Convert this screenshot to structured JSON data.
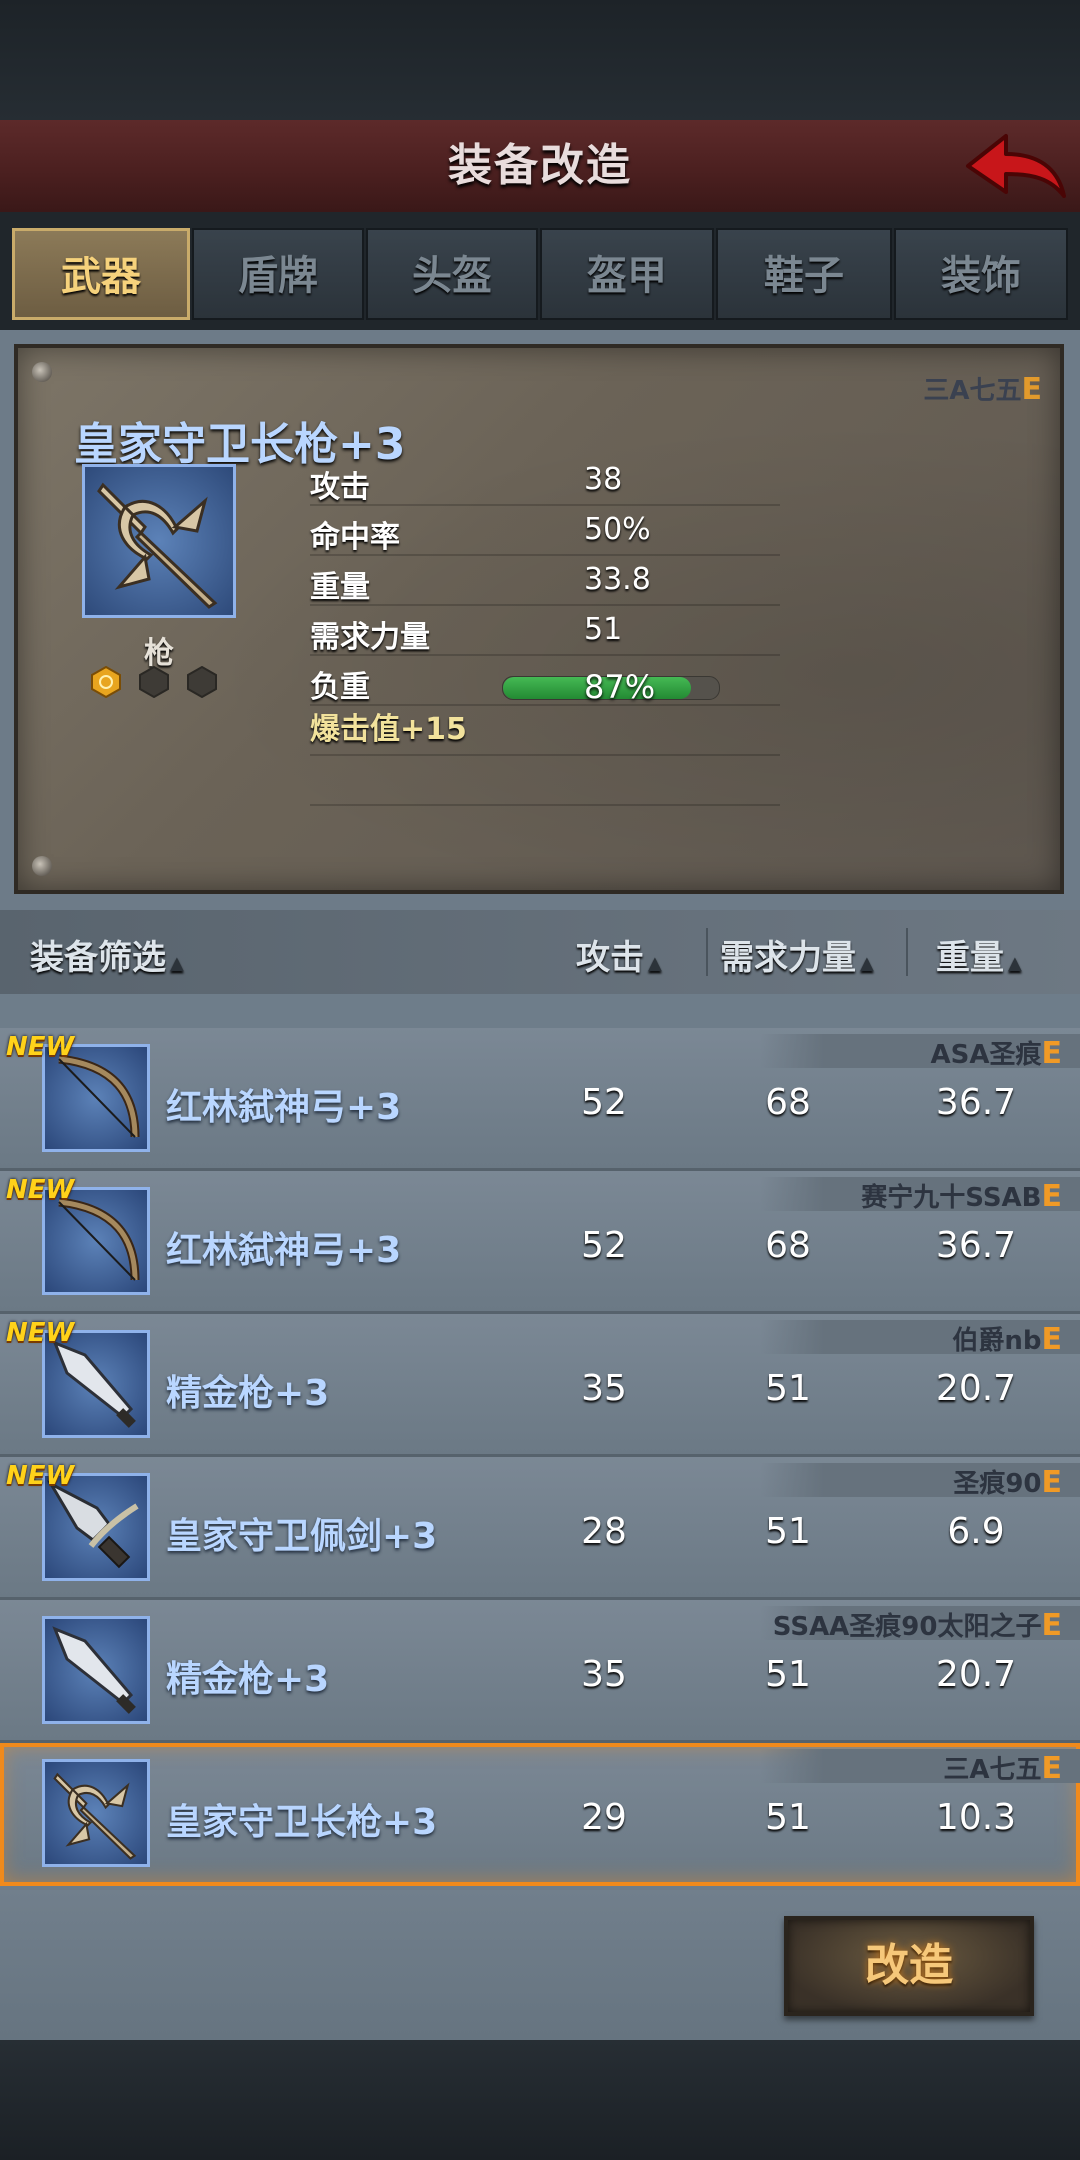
{
  "header": {
    "title": "装备改造",
    "back_icon": "red-back-arrow-icon"
  },
  "tabs": [
    {
      "label": "武器",
      "active": true
    },
    {
      "label": "盾牌",
      "active": false
    },
    {
      "label": "头盔",
      "active": false
    },
    {
      "label": "盔甲",
      "active": false
    },
    {
      "label": "鞋子",
      "active": false
    },
    {
      "label": "装饰",
      "active": false
    }
  ],
  "detail": {
    "title": "皇家守卫长枪+3",
    "owner": "三A七五",
    "grade": "E",
    "type": "枪",
    "icon": "trident-icon",
    "gems": [
      "gold-gem-icon",
      "empty-gem-slot-icon",
      "empty-gem-slot-icon"
    ],
    "stats": [
      {
        "label": "攻击",
        "value": "38"
      },
      {
        "label": "命中率",
        "value": "50%"
      },
      {
        "label": "重量",
        "value": "33.8"
      },
      {
        "label": "需求力量",
        "value": "51"
      },
      {
        "label": "负重",
        "value": "87%"
      }
    ],
    "load_fraction": 0.87,
    "bonus": "爆击值+15"
  },
  "list": {
    "headers": {
      "filter": "装备筛选",
      "attack": "攻击",
      "strength": "需求力量",
      "weight": "重量"
    },
    "rows": [
      {
        "new": "NEW",
        "name": "红林弑神弓+3",
        "attack": "52",
        "strength": "68",
        "weight": "36.7",
        "owner": "ASA圣痕",
        "grade": "E",
        "icon": "bow-icon",
        "selected": false
      },
      {
        "new": "NEW",
        "name": "红林弑神弓+3",
        "attack": "52",
        "strength": "68",
        "weight": "36.7",
        "owner": "赛宁九十SSAB",
        "grade": "E",
        "icon": "bow-icon",
        "selected": false
      },
      {
        "new": "NEW",
        "name": "精金枪+3",
        "attack": "35",
        "strength": "51",
        "weight": "20.7",
        "owner": "伯爵nb",
        "grade": "E",
        "icon": "spear-icon",
        "selected": false
      },
      {
        "new": "NEW",
        "name": "皇家守卫佩剑+3",
        "attack": "28",
        "strength": "51",
        "weight": "6.9",
        "owner": "圣痕90",
        "grade": "E",
        "icon": "sword-icon",
        "selected": false
      },
      {
        "new": "",
        "name": "精金枪+3",
        "attack": "35",
        "strength": "51",
        "weight": "20.7",
        "owner": "SSAA圣痕90太阳之子",
        "grade": "E",
        "icon": "spear-icon",
        "selected": false
      },
      {
        "new": "",
        "name": "皇家守卫长枪+3",
        "attack": "29",
        "strength": "51",
        "weight": "10.3",
        "owner": "三A七五",
        "grade": "E",
        "icon": "trident-icon",
        "selected": true
      }
    ]
  },
  "action": {
    "reforge_label": "改造"
  }
}
